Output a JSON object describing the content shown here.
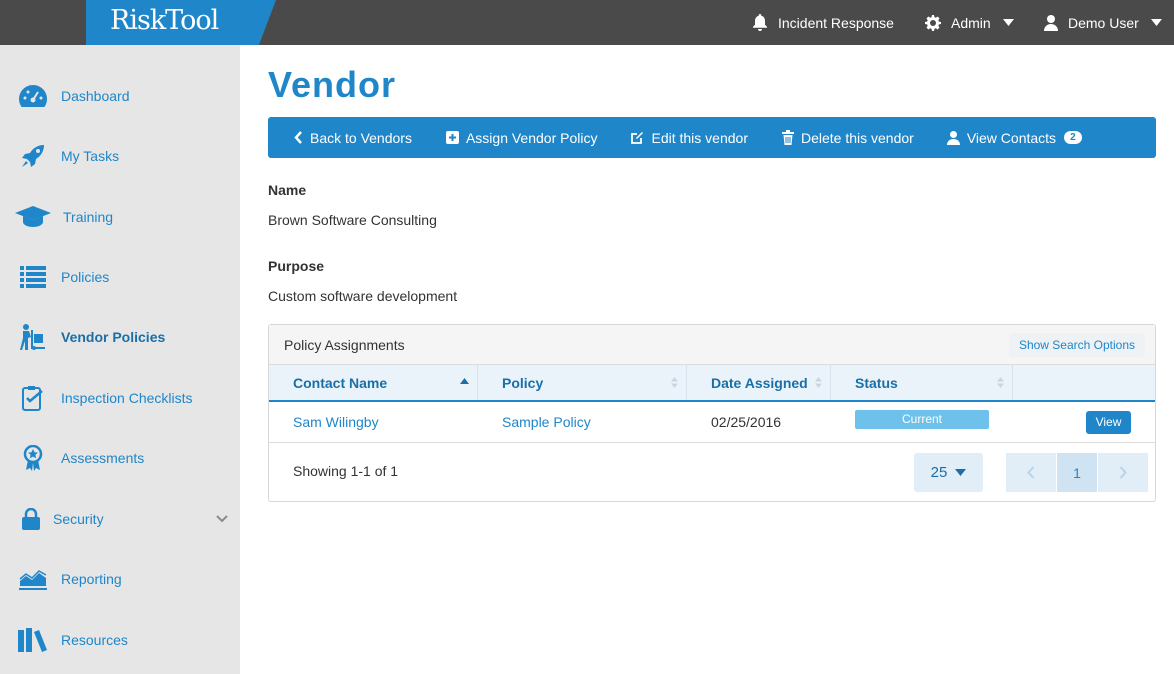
{
  "app": {
    "logo": "RiskTool"
  },
  "topbar": {
    "incident": "Incident Response",
    "admin": "Admin",
    "user": "Demo User"
  },
  "sidebar": {
    "items": [
      {
        "label": "Dashboard",
        "icon": "dashboard-gauge-icon"
      },
      {
        "label": "My Tasks",
        "icon": "rocket-icon"
      },
      {
        "label": "Training",
        "icon": "graduation-cap-icon"
      },
      {
        "label": "Policies",
        "icon": "list-icon"
      },
      {
        "label": "Vendor Policies",
        "icon": "vendor-dolly-icon",
        "active": true
      },
      {
        "label": "Inspection Checklists",
        "icon": "clipboard-check-icon"
      },
      {
        "label": "Assessments",
        "icon": "award-ribbon-icon"
      },
      {
        "label": "Security",
        "icon": "lock-icon"
      },
      {
        "label": "Reporting",
        "icon": "area-chart-icon"
      },
      {
        "label": "Resources",
        "icon": "books-icon"
      }
    ]
  },
  "page": {
    "title": "Vendor"
  },
  "actions": {
    "back": "Back to Vendors",
    "assign": "Assign Vendor Policy",
    "edit": "Edit this vendor",
    "delete": "Delete this vendor",
    "contacts": "View Contacts",
    "contacts_count": "2"
  },
  "vendor": {
    "name_label": "Name",
    "name": "Brown Software Consulting",
    "purpose_label": "Purpose",
    "purpose": "Custom software development"
  },
  "assignments": {
    "title": "Policy Assignments",
    "search_toggle": "Show Search Options",
    "columns": [
      "Contact Name",
      "Policy",
      "Date Assigned",
      "Status"
    ],
    "rows": [
      {
        "contact": "Sam Wilingby",
        "policy": "Sample Policy",
        "date": "02/25/2016",
        "status": "Current",
        "action": "View"
      }
    ],
    "showing": "Showing 1-1 of 1",
    "per_page": "25",
    "current_page": "1"
  },
  "colors": {
    "brand": "#1f86c9",
    "topbar": "#4a4a4a",
    "sidebar": "#e6e6e6",
    "status_current": "#6ec1ea"
  }
}
